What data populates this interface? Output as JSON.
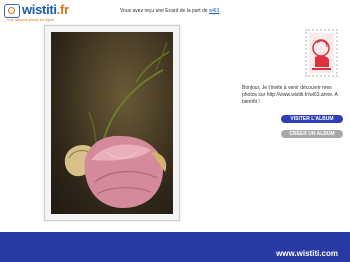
{
  "header": {
    "logo_text": "wistiti",
    "logo_ext": ".fr",
    "logo_tagline": "Vos albums photo en ligne",
    "notice_prefix": "Vous avez reçu une Ecard de la part de",
    "sender_link": "wi63"
  },
  "message": {
    "text": "Bonjour, Je t'invite à venir découvrir mes photos sur http://www.wistiti.fr/wi63.anne. A bientôt !"
  },
  "buttons": {
    "visit_label": "VISITER L'ALBUM",
    "create_label": "CRÉER UN ALBUM"
  },
  "footer": {
    "url": "www.wistiti.com"
  },
  "colors": {
    "brand_blue": "#2a3aa4",
    "accent_orange": "#e2711d",
    "button_blue": "#2b40b8",
    "button_grey": "#a9a9a9"
  }
}
